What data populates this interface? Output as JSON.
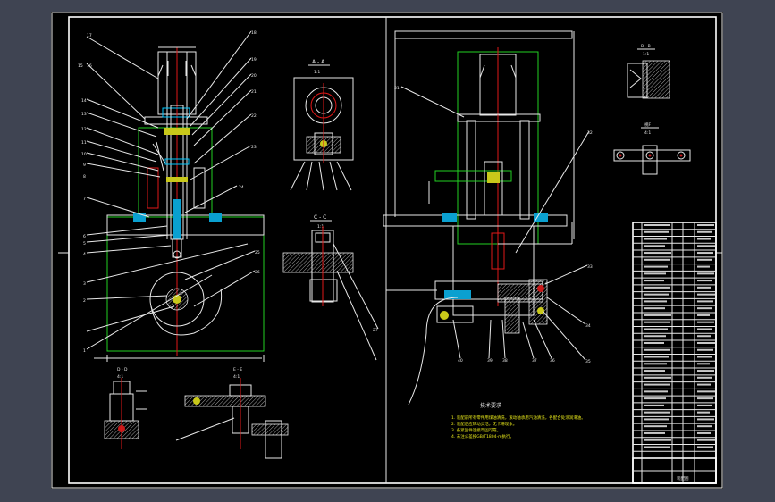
{
  "sheet": {
    "accent": "#22d022",
    "line_color": "#e8e8e8",
    "background": "#000000"
  },
  "views": {
    "section_a": {
      "label_top": "A - A",
      "label_bottom": "1:1"
    },
    "section_b": {
      "label_top": "B - B",
      "label_bottom": "1:1"
    },
    "section_c": {
      "label_top": "C - C",
      "label_bottom": "1:1"
    },
    "section_d": {
      "label_top": "D - D",
      "label_bottom": "4:1"
    },
    "section_e": {
      "label_top": "E - E",
      "label_bottom": "4:1"
    },
    "view_f": {
      "label_top": "视F",
      "label_bottom": "4:1"
    },
    "detail_i": {
      "label_top": "I",
      "label_bottom": "4:1"
    }
  },
  "left_callouts": [
    "15",
    "16",
    "14",
    "13",
    "12",
    "11",
    "10",
    "9",
    "8",
    "7",
    "6",
    "5",
    "4",
    "3",
    "2",
    "1"
  ],
  "top_callouts": [
    "17",
    "18",
    "19",
    "20",
    "21",
    "22",
    "23",
    "24",
    "25",
    "26",
    "27"
  ],
  "right_callouts": [
    "31",
    "32",
    "33",
    "34",
    "35",
    "36",
    "37",
    "38",
    "39",
    "40",
    "41",
    "42",
    "43",
    "44",
    "45",
    "46"
  ],
  "tech_requirements": {
    "title": "技术要求",
    "lines": [
      "1. 装配前所有零件用煤油清洗，滚动轴承用汽油清洗，各配合处涂润滑油。",
      "2. 装配后应转动灵活，无卡滞现象。",
      "3. 各紧固件连接牢固可靠。",
      "4. 未注公差按GB/T1804-m执行。"
    ]
  },
  "title_block": {
    "rows": 34,
    "label": "装配图"
  }
}
